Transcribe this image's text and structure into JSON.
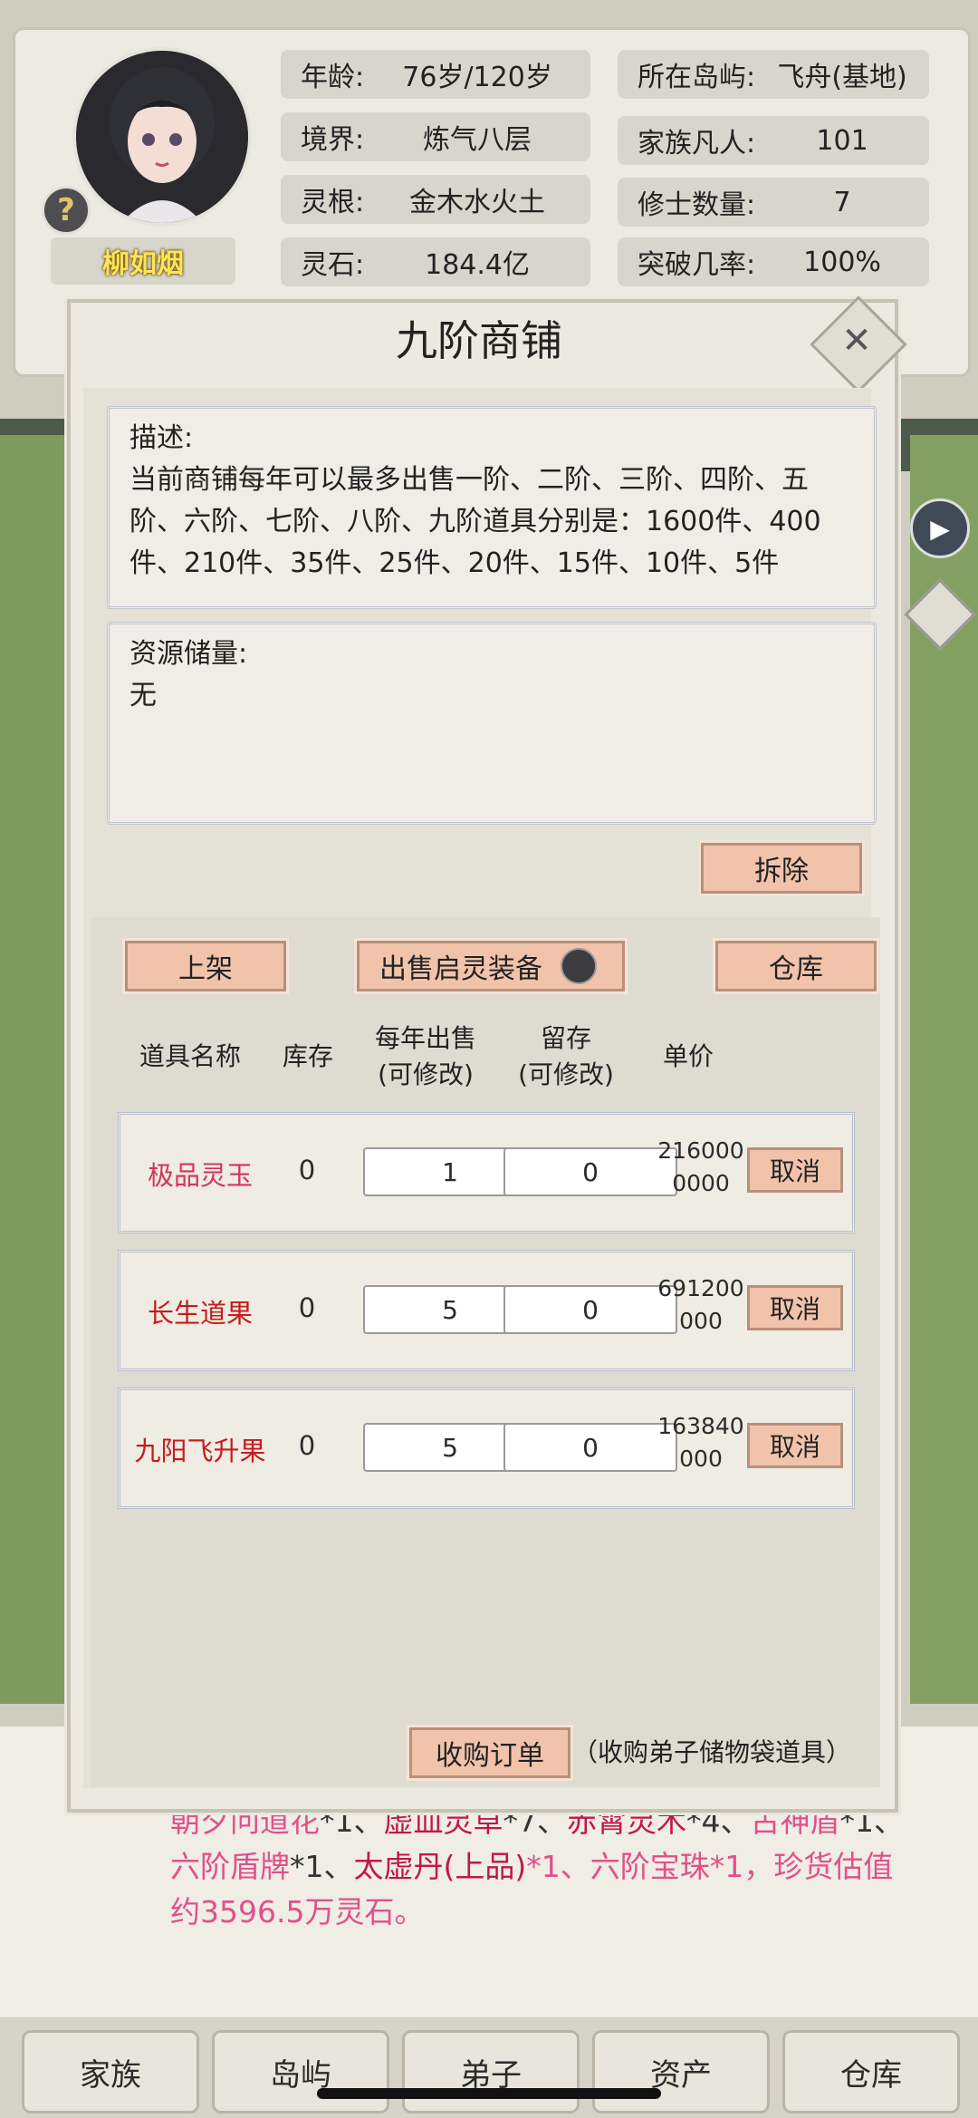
{
  "player": {
    "name": "柳如烟",
    "stats_left": [
      {
        "label": "年龄:",
        "value": "76岁/120岁"
      },
      {
        "label": "境界:",
        "value": "炼气八层"
      },
      {
        "label": "灵根:",
        "value": "金木水火土"
      },
      {
        "label": "灵石:",
        "value": "184.4亿"
      }
    ],
    "stats_right": [
      {
        "label": "所在岛屿:",
        "value": "飞舟(基地)"
      },
      {
        "label": "家族凡人:",
        "value": "101"
      },
      {
        "label": "修士数量:",
        "value": "7"
      },
      {
        "label": "突破几率:",
        "value": "100%"
      }
    ]
  },
  "modal": {
    "title": "九阶商铺",
    "description_label": "描述:",
    "description_text": "当前商铺每年可以最多出售一阶、二阶、三阶、四阶、五阶、六阶、七阶、八阶、九阶道具分别是：1600件、400件、210件、35件、25件、20件、15件、10件、5件",
    "resources_label": "资源储量:",
    "resources_value": "无",
    "demolish_label": "拆除",
    "list_button": "上架",
    "sell_toggle_label": "出售启灵装备",
    "warehouse_button": "仓库",
    "headers": {
      "name": "道具名称",
      "stock": "库存",
      "yearly_l1": "每年出售",
      "yearly_l2": "(可修改)",
      "reserve_l1": "留存",
      "reserve_l2": "(可修改)",
      "price": "单价"
    },
    "items": [
      {
        "name": "极品灵玉",
        "stock": "0",
        "yearly": "1",
        "reserve": "0",
        "price_l1": "216000",
        "price_l2": "0000",
        "action": "取消"
      },
      {
        "name": "长生道果",
        "stock": "0",
        "yearly": "5",
        "reserve": "0",
        "price_l1": "691200",
        "price_l2": "000",
        "action": "取消"
      },
      {
        "name": "九阳飞升果",
        "stock": "0",
        "yearly": "5",
        "reserve": "0",
        "price_l1": "163840",
        "price_l2": "000",
        "action": "取消"
      }
    ],
    "purchase_button": "收购订单",
    "purchase_note": "（收购弟子储物袋道具）"
  },
  "background": {
    "loot_line1_parts": [
      "朝夕问道花",
      "*1、",
      "虚血灵草",
      "*7、",
      "赤霄灵木",
      "*4、",
      "古神盾",
      "*1、"
    ],
    "loot_line2_parts": [
      "六阶盾牌",
      "*1、",
      "太虚丹(上品)",
      "*1、六阶宝珠*1，珍货估值"
    ],
    "loot_line3": "约3596.5万灵石。"
  },
  "tabs": [
    "家族",
    "岛屿",
    "弟子",
    "资产",
    "仓库"
  ],
  "colors": {
    "item_name": "#d6335e",
    "orange_button": "#f1c3aa",
    "pink_text": "#e0508a"
  }
}
